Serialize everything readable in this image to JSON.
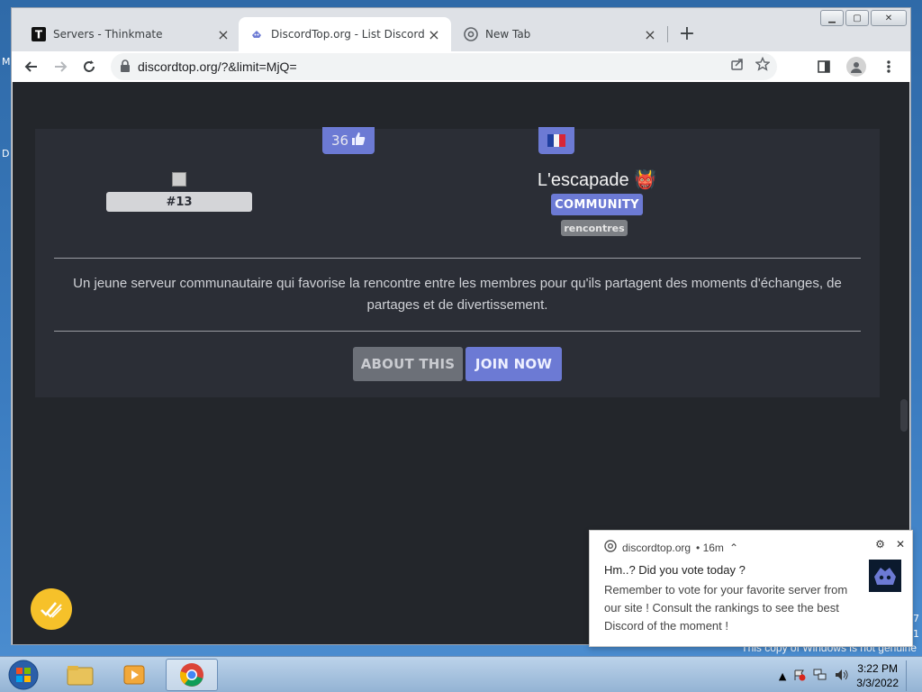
{
  "desktop": {
    "frag_left_1": "M",
    "frag_left_2": "D",
    "frag_right_1": "7",
    "frag_right_2": "1",
    "watermark": "This copy of Windows is not genuine"
  },
  "browser": {
    "tabs": [
      {
        "title": "Servers - Thinkmate",
        "icon": "thinkmate-t-icon"
      },
      {
        "title": "DiscordTop.org - List Discord ser",
        "icon": "discordtop-icon"
      },
      {
        "title": "New Tab",
        "icon": "chrome-icon"
      }
    ],
    "url": "discordtop.org/?&limit=MjQ="
  },
  "card": {
    "rank": "#13",
    "votes": "36",
    "flag": "france-flag-icon",
    "server_name": "L'escapade",
    "server_emoji": "👹",
    "category": "COMMUNITY",
    "tag": "rencontres",
    "description": "Un jeune serveur communautaire qui favorise la rencontre entre les membres pour qu'ils partagent des moments d'échanges, de partages et de divertissement.",
    "about_label": "ABOUT THIS",
    "join_label": "JOIN NOW"
  },
  "notification": {
    "source": "discordtop.org",
    "time": "• 16m",
    "title": "Hm..? Did you vote today ?",
    "body": "Remember to vote for your favorite server from our site ! Consult the rankings to see the best Discord of the moment !"
  },
  "taskbar": {
    "time": "3:22 PM",
    "date": "3/3/2022"
  },
  "colors": {
    "accent": "#6c7ad4",
    "page_bg": "#23262b",
    "card_bg": "#2b2e36"
  }
}
